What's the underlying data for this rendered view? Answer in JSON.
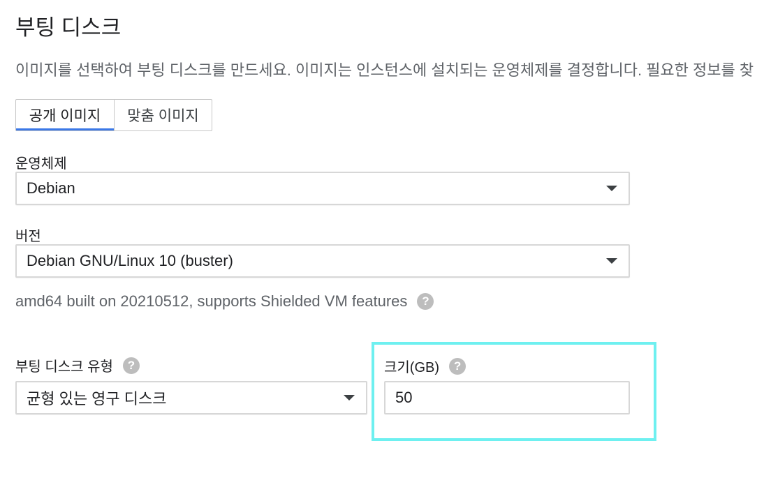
{
  "page": {
    "title": "부팅 디스크",
    "description": "이미지를 선택하여 부팅 디스크를 만드세요. 이미지는 인스턴스에 설치되는 운영체제를 결정합니다. 필요한 정보를 찾"
  },
  "tabs": [
    {
      "label": "공개 이미지",
      "selected": true
    },
    {
      "label": "맞춤 이미지",
      "selected": false
    }
  ],
  "os": {
    "label": "운영체제",
    "value": "Debian"
  },
  "version": {
    "label": "버전",
    "value": "Debian GNU/Linux 10 (buster)",
    "note": "amd64 built on 20210512, supports Shielded VM features"
  },
  "disk_type": {
    "label": "부팅 디스크 유형",
    "value": "균형 있는 영구 디스크"
  },
  "disk_size": {
    "label": "크기(GB)",
    "value": "50"
  },
  "icons": {
    "help": "?"
  },
  "colors": {
    "accent_tab_underline": "#3b78e7",
    "highlight_border": "#6ef0f0",
    "help_icon_bg": "#bdbdbd"
  }
}
